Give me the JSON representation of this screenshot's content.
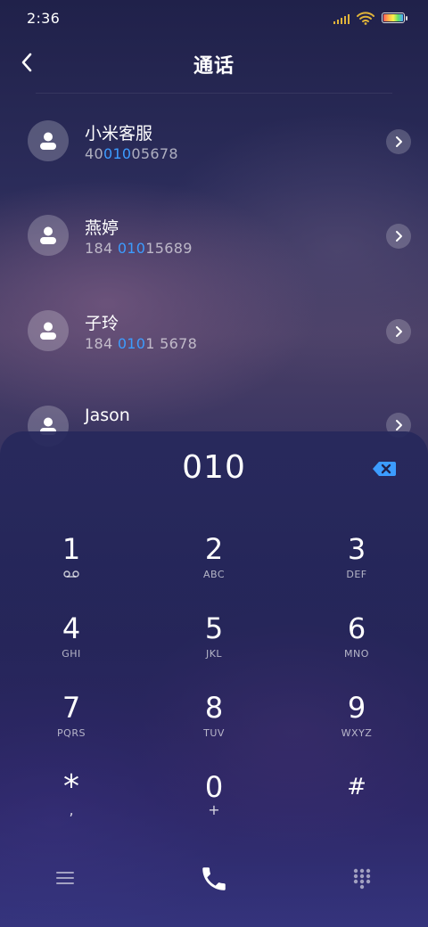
{
  "status_bar": {
    "time": "2:36"
  },
  "header": {
    "title": "通话"
  },
  "contacts": [
    {
      "name": "小米客服",
      "number_pre": "40",
      "number_match": "010",
      "number_post": "05678"
    },
    {
      "name": "燕婷",
      "number_pre": "184 ",
      "number_match": "010",
      "number_post": "15689"
    },
    {
      "name": "子玲",
      "number_pre": "184 ",
      "number_match": "010",
      "number_post": "1 5678"
    },
    {
      "name": "Jason",
      "number_pre": "",
      "number_match": "",
      "number_post": ""
    }
  ],
  "dialer": {
    "input": "010",
    "keys": [
      {
        "digit": "1",
        "letters": ""
      },
      {
        "digit": "2",
        "letters": "ABC"
      },
      {
        "digit": "3",
        "letters": "DEF"
      },
      {
        "digit": "4",
        "letters": "GHI"
      },
      {
        "digit": "5",
        "letters": "JKL"
      },
      {
        "digit": "6",
        "letters": "MNO"
      },
      {
        "digit": "7",
        "letters": "PQRS"
      },
      {
        "digit": "8",
        "letters": "TUV"
      },
      {
        "digit": "9",
        "letters": "WXYZ"
      },
      {
        "digit": "*",
        "letters": ","
      },
      {
        "digit": "0",
        "letters": "+"
      },
      {
        "digit": "#",
        "letters": ""
      }
    ]
  },
  "icons": {
    "back": "chevron-left-icon",
    "avatar": "person-icon",
    "detail": "chevron-right-icon",
    "backspace": "backspace-icon",
    "voicemail": "voicemail-icon",
    "menu": "menu-icon",
    "call": "phone-icon",
    "keypad": "dialpad-icon"
  },
  "colors": {
    "accent": "#3c9cff",
    "signal": "#e0b43a"
  }
}
